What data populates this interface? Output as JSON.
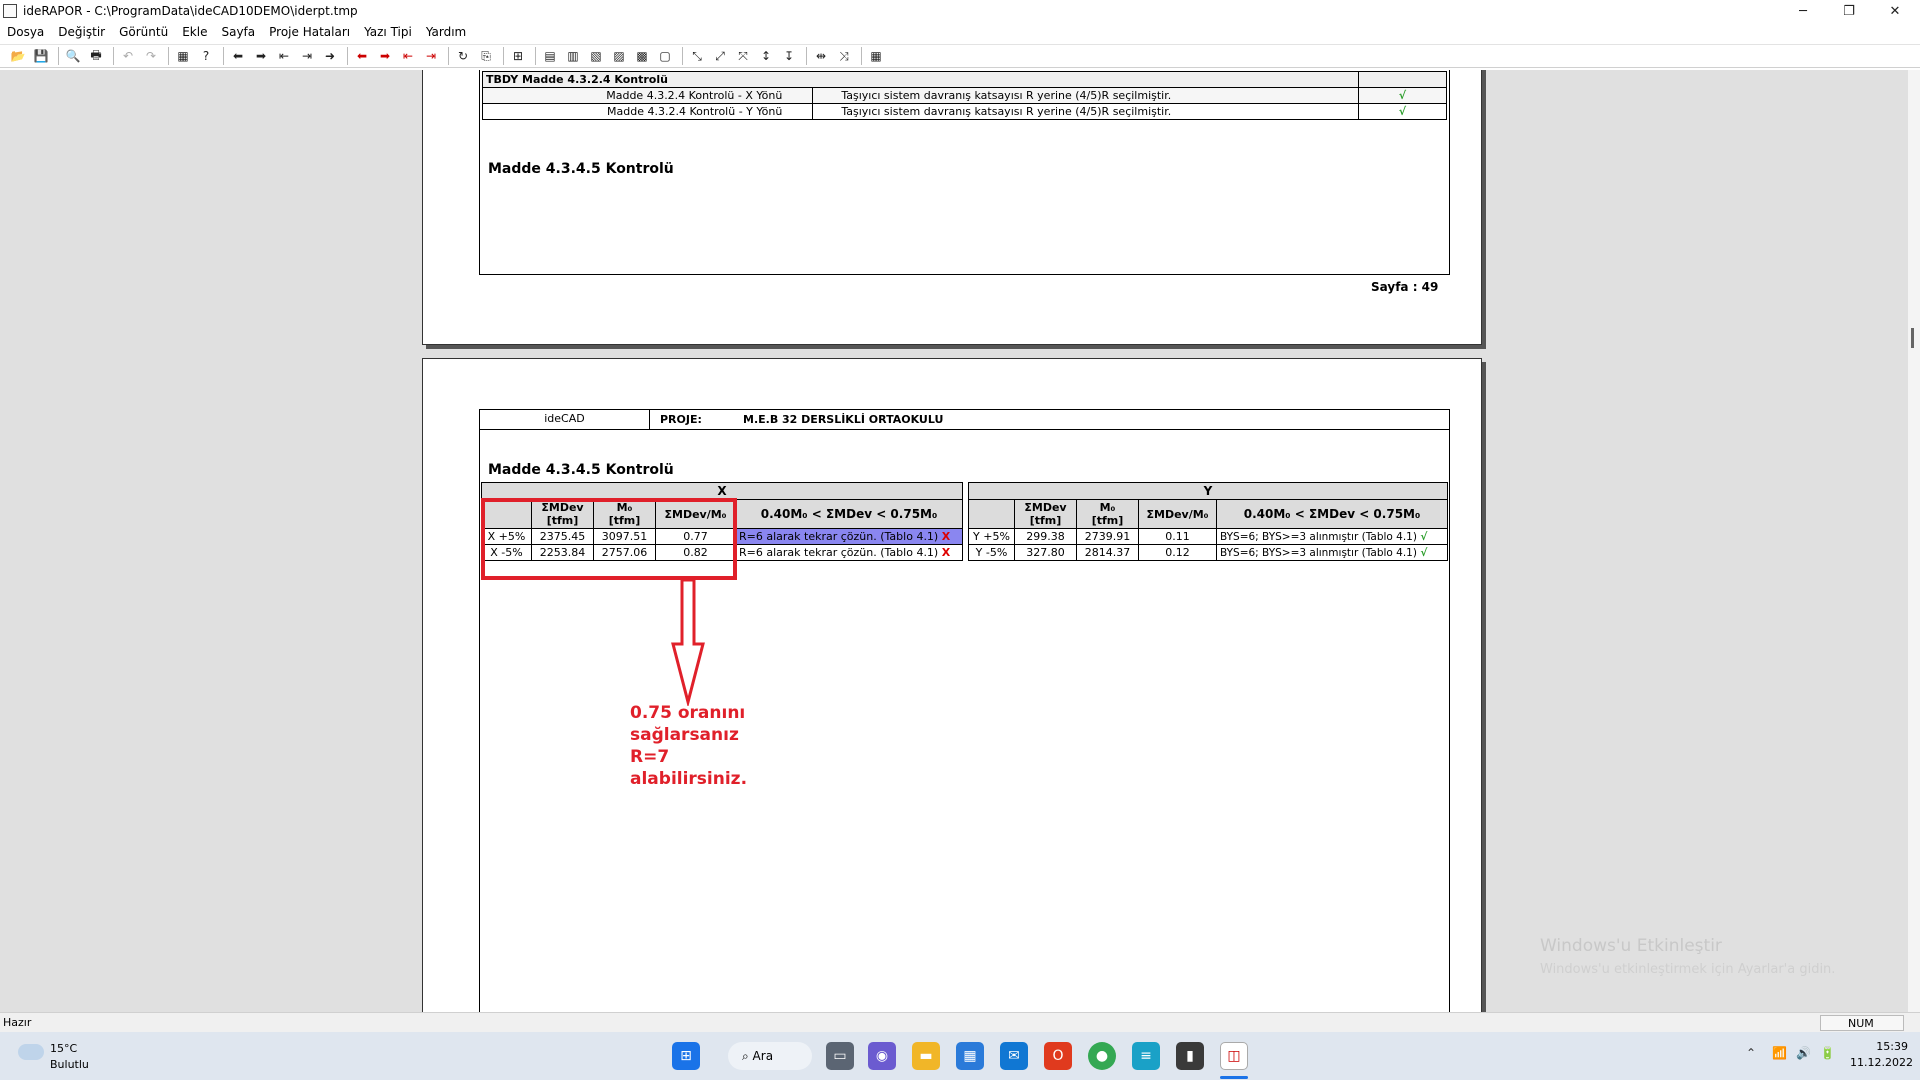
{
  "window": {
    "title": "ideRAPOR - C:\\ProgramData\\ideCAD10DEMO\\iderpt.tmp",
    "minimize_glyph": "─",
    "maximize_glyph": "❐",
    "close_glyph": "✕"
  },
  "menu": [
    "Dosya",
    "Değiştir",
    "Görüntü",
    "Ekle",
    "Sayfa",
    "Proje Hataları",
    "Yazı Tipi",
    "Yardım"
  ],
  "page1": {
    "table_title": "TBDY Madde 4.3.2.4 Kontrolü",
    "rows": [
      {
        "label": "Madde 4.3.2.4 Kontrolü - X Yönü",
        "desc": "Taşıyıcı sistem davranış katsayısı R yerine (4/5)R seçilmiştir.",
        "mark": "√"
      },
      {
        "label": "Madde 4.3.2.4 Kontrolü - Y Yönü",
        "desc": "Taşıyıcı sistem davranış katsayısı R yerine (4/5)R seçilmiştir.",
        "mark": "√"
      }
    ],
    "section_title": "Madde 4.3.4.5 Kontrolü",
    "page_number": "Sayfa : 49"
  },
  "page2": {
    "logo": "ideCAD",
    "proje_label": "PROJE:",
    "proje_name": "M.E.B 32 DERSLİKLİ ORTAOKULU",
    "section_title": "Madde 4.3.4.5 Kontrolü",
    "x_table": {
      "header": "X",
      "cols": [
        "ΣMDev\n[tfm]",
        "M₀\n[tfm]",
        "ΣMDev/M₀",
        "0.40M₀ < ΣMDev < 0.75M₀"
      ],
      "rows": [
        {
          "label": "X +5%",
          "mdev": "2375.45",
          "m0": "3097.51",
          "ratio": "0.77",
          "result": "R=6 alarak tekrar çözün. (Tablo 4.1)",
          "mark": "X"
        },
        {
          "label": "X -5%",
          "mdev": "2253.84",
          "m0": "2757.06",
          "ratio": "0.82",
          "result": "R=6 alarak tekrar çözün. (Tablo 4.1)",
          "mark": "X"
        }
      ]
    },
    "y_table": {
      "header": "Y",
      "cols": [
        "ΣMDev\n[tfm]",
        "M₀\n[tfm]",
        "ΣMDev/M₀",
        "0.40M₀ < ΣMDev < 0.75M₀"
      ],
      "rows": [
        {
          "label": "Y +5%",
          "mdev": "299.38",
          "m0": "2739.91",
          "ratio": "0.11",
          "result": "BYS=6; BYS>=3 alınmıştır (Tablo 4.1)",
          "mark": "√"
        },
        {
          "label": "Y -5%",
          "mdev": "327.80",
          "m0": "2814.37",
          "ratio": "0.12",
          "result": "BYS=6; BYS>=3 alınmıştır (Tablo 4.1)",
          "mark": "√"
        }
      ]
    },
    "annotation": "0.75 oranını\nsağlarsanız\nR=7\nalabilirsiniz."
  },
  "watermark": {
    "line1": "Windows'u Etkinleştir",
    "line2": "Windows'u etkinleştirmek için Ayarlar'a gidin."
  },
  "statusbar": {
    "left": "Hazır",
    "indicator": "NUM"
  },
  "taskbar": {
    "weather_temp": "15°C",
    "weather_desc": "Bulutlu",
    "search_label": "Ara",
    "time": "15:39",
    "date": "11.12.2022"
  },
  "colors": {
    "annotation_red": "#e0202a",
    "highlight": "#8a86f0",
    "check_green": "#2a9d2a"
  }
}
